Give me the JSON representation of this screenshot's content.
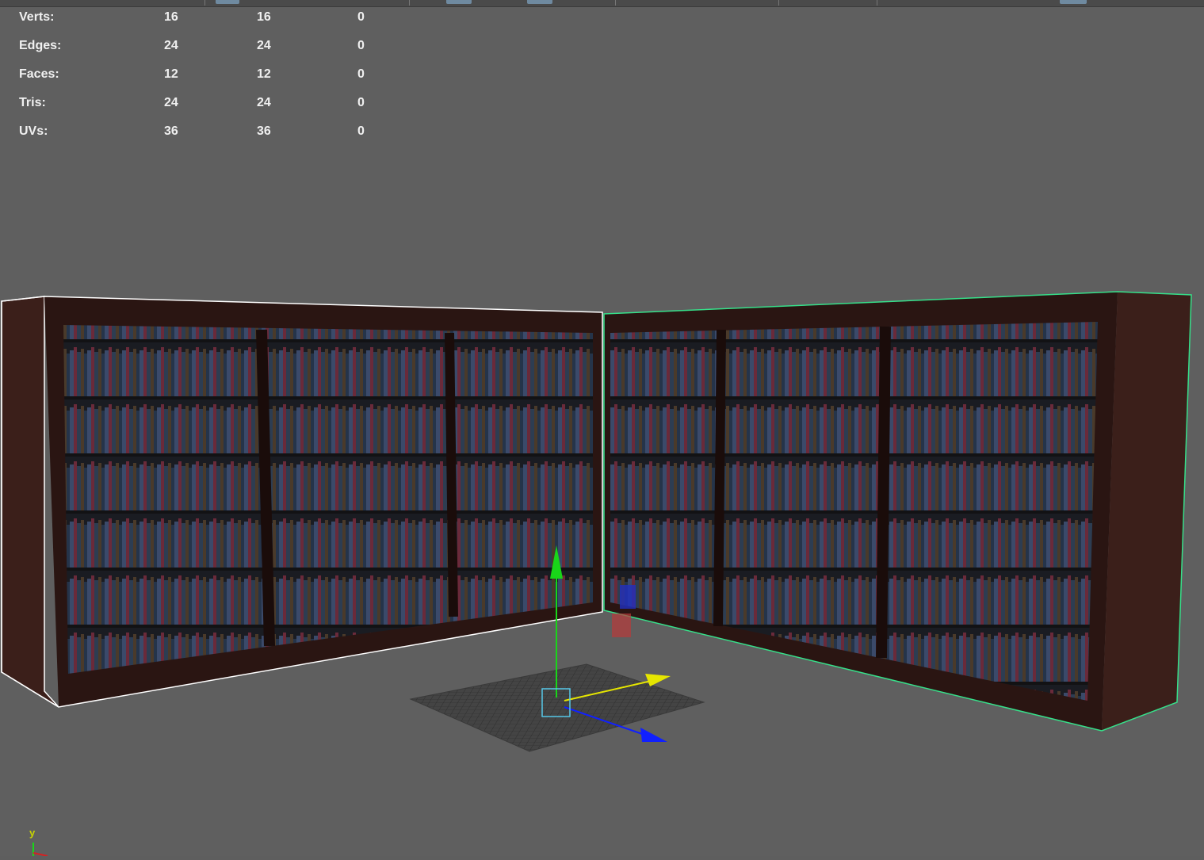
{
  "hud": {
    "rows": [
      {
        "label": "Verts:",
        "c1": "16",
        "c2": "16",
        "c3": "0"
      },
      {
        "label": "Edges:",
        "c1": "24",
        "c2": "24",
        "c3": "0"
      },
      {
        "label": "Faces:",
        "c1": "12",
        "c2": "12",
        "c3": "0"
      },
      {
        "label": "Tris:",
        "c1": "24",
        "c2": "24",
        "c3": "0"
      },
      {
        "label": "UVs:",
        "c1": "36",
        "c2": "36",
        "c3": "0"
      }
    ]
  },
  "axis_indicator": {
    "y_label": "y"
  },
  "colors": {
    "viewport_bg": "#5f5f5f",
    "selection_outline": "#36e08a",
    "wire_outline": "#ffffff",
    "manip_y": "#19d619",
    "manip_x": "#e6e600",
    "manip_z": "#1020ff",
    "pivot": "#56c8e8"
  },
  "icons": [
    "move-manipulator-icon",
    "view-axis-icon"
  ]
}
